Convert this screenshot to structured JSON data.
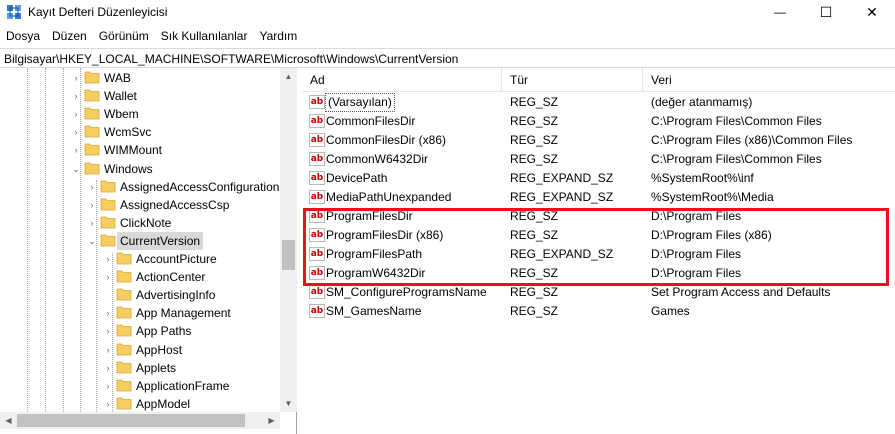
{
  "window": {
    "title": "Kayıt Defteri Düzenleyicisi",
    "minimize_glyph": "—",
    "maximize_glyph": "☐",
    "close_glyph": "✕"
  },
  "menu": [
    "Dosya",
    "Düzen",
    "Görünüm",
    "Sık Kullanılanlar",
    "Yardım"
  ],
  "address": "Bilgisayar\\HKEY_LOCAL_MACHINE\\SOFTWARE\\Microsoft\\Windows\\CurrentVersion",
  "tree": {
    "folder_color": "#f5cd60",
    "nodes": [
      {
        "label": "WAB",
        "expander": "›",
        "level": 0
      },
      {
        "label": "Wallet",
        "expander": "›",
        "level": 0
      },
      {
        "label": "Wbem",
        "expander": "›",
        "level": 0
      },
      {
        "label": "WcmSvc",
        "expander": "›",
        "level": 0
      },
      {
        "label": "WIMMount",
        "expander": "›",
        "level": 0
      },
      {
        "label": "Windows",
        "expander": "⌄",
        "level": 0
      },
      {
        "label": "AssignedAccessConfiguration",
        "expander": "›",
        "level": 1
      },
      {
        "label": "AssignedAccessCsp",
        "expander": "›",
        "level": 1
      },
      {
        "label": "ClickNote",
        "expander": "›",
        "level": 1
      },
      {
        "label": "CurrentVersion",
        "expander": "⌄",
        "level": 1,
        "selected": true
      },
      {
        "label": "AccountPicture",
        "expander": "›",
        "level": 2
      },
      {
        "label": "ActionCenter",
        "expander": "›",
        "level": 2
      },
      {
        "label": "AdvertisingInfo",
        "expander": "",
        "level": 2
      },
      {
        "label": "App Management",
        "expander": "›",
        "level": 2
      },
      {
        "label": "App Paths",
        "expander": "›",
        "level": 2
      },
      {
        "label": "AppHost",
        "expander": "›",
        "level": 2
      },
      {
        "label": "Applets",
        "expander": "›",
        "level": 2
      },
      {
        "label": "ApplicationFrame",
        "expander": "›",
        "level": 2
      },
      {
        "label": "AppModel",
        "expander": "›",
        "level": 2
      }
    ]
  },
  "values": {
    "columns": [
      "Ad",
      "Tür",
      "Veri"
    ],
    "icon_text": "ab",
    "highlight_color": "#e8121e",
    "rows": [
      {
        "name": "(Varsayılan)",
        "type": "REG_SZ",
        "data": "(değer atanmamış)"
      },
      {
        "name": "CommonFilesDir",
        "type": "REG_SZ",
        "data": "C:\\Program Files\\Common Files"
      },
      {
        "name": "CommonFilesDir (x86)",
        "type": "REG_SZ",
        "data": "C:\\Program Files (x86)\\Common Files"
      },
      {
        "name": "CommonW6432Dir",
        "type": "REG_SZ",
        "data": "C:\\Program Files\\Common Files"
      },
      {
        "name": "DevicePath",
        "type": "REG_EXPAND_SZ",
        "data": "%SystemRoot%\\inf"
      },
      {
        "name": "MediaPathUnexpanded",
        "type": "REG_EXPAND_SZ",
        "data": "%SystemRoot%\\Media"
      },
      {
        "name": "ProgramFilesDir",
        "type": "REG_SZ",
        "data": "D:\\Program Files"
      },
      {
        "name": "ProgramFilesDir (x86)",
        "type": "REG_SZ",
        "data": "D:\\Program Files (x86)"
      },
      {
        "name": "ProgramFilesPath",
        "type": "REG_EXPAND_SZ",
        "data": "D:\\Program Files"
      },
      {
        "name": "ProgramW6432Dir",
        "type": "REG_SZ",
        "data": "D:\\Program Files"
      },
      {
        "name": "SM_ConfigureProgramsName",
        "type": "REG_SZ",
        "data": "Set Program Access and Defaults"
      },
      {
        "name": "SM_GamesName",
        "type": "REG_SZ",
        "data": "Games"
      }
    ]
  }
}
